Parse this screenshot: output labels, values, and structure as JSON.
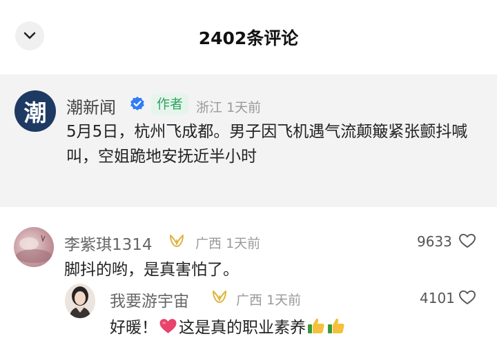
{
  "header": {
    "title": "2402条评论",
    "back_icon": "chevron-down-icon"
  },
  "pinned_comment": {
    "avatar_char": "潮",
    "author": "潮新闻",
    "verified_icon": "verified-badge-icon",
    "author_tag": "作者",
    "location": "浙江",
    "time": "1天前",
    "text": "5月5日，杭州飞成都。男子因飞机遇气流颠簸紧张颤抖喊叫，空姐跪地安抚近半小时"
  },
  "comments": [
    {
      "username": "李紫琪1314",
      "badge_icon": "crown-icon",
      "location": "广西",
      "time": "1天前",
      "text": "脚抖的哟，是真害怕了。",
      "likes": "9633",
      "like_icon": "heart-outline-icon",
      "replies": [
        {
          "username": "我要游宇宙",
          "badge_icon": "crown-icon",
          "location": "广西",
          "time": "1天前",
          "text_before_emoji": "好暖！",
          "text_after_emoji": "这是真的职业素养",
          "emoji_icons": [
            "red-heart-emoji",
            "thumbs-up-emoji",
            "thumbs-up-emoji"
          ],
          "likes": "4101",
          "like_icon": "heart-outline-icon"
        }
      ]
    }
  ],
  "colors": {
    "pinned_bg": "#f3f3f3",
    "author_tag_text": "#2da361",
    "author_tag_bg": "#e6f5ec",
    "verified_blue": "#2f7cf6",
    "crown_gold": "#e0b33c",
    "emoji_heart": "#e8436b"
  }
}
